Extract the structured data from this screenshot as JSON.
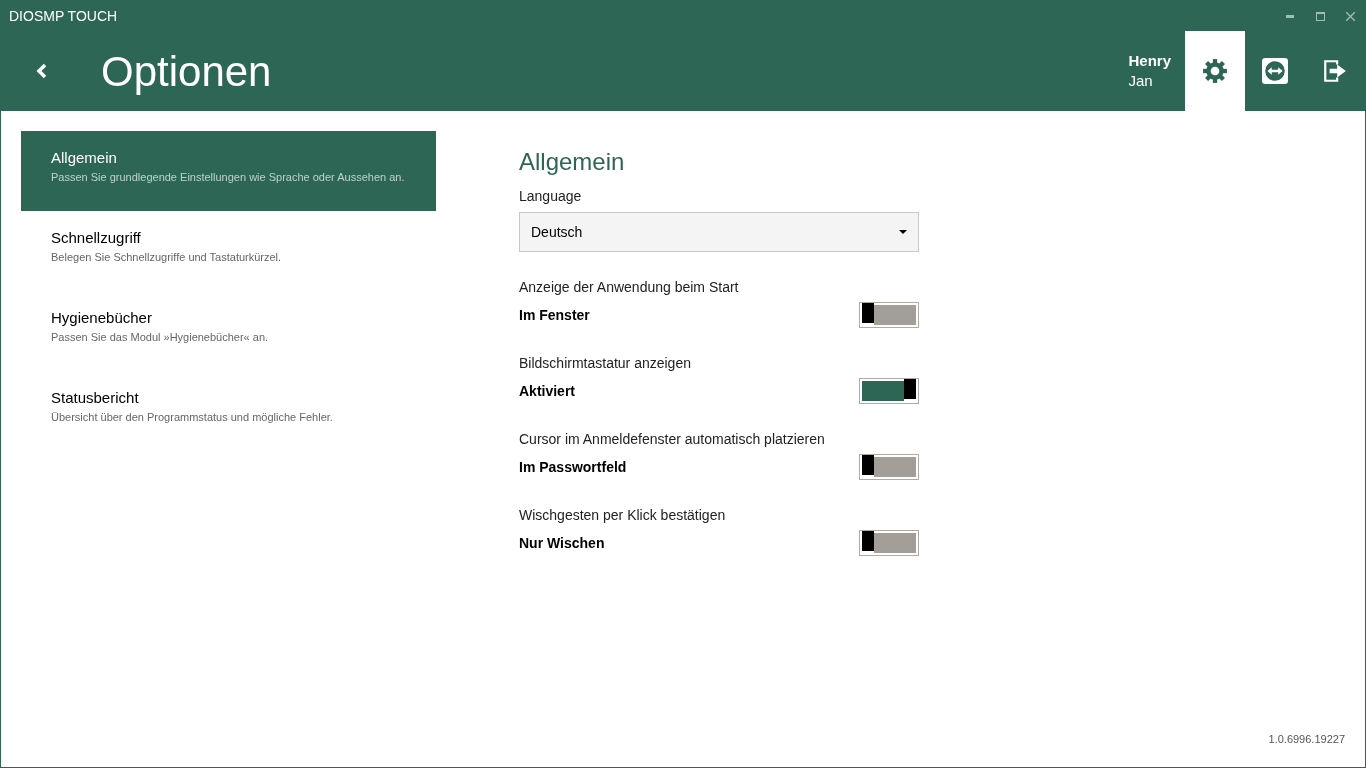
{
  "window": {
    "title": "DIOSMP TOUCH"
  },
  "header": {
    "title": "Optionen",
    "user": {
      "first": "Henry",
      "last": "Jan"
    },
    "actions": [
      {
        "kind": "settings",
        "selected": true
      },
      {
        "kind": "remote",
        "selected": false
      },
      {
        "kind": "logout",
        "selected": false
      }
    ]
  },
  "sidebar": {
    "items": [
      {
        "title": "Allgemein",
        "description": "Passen Sie grundlegende Einstellungen wie Sprache oder Aussehen an.",
        "selected": true
      },
      {
        "title": "Schnellzugriff",
        "description": "Belegen Sie Schnellzugriffe und Tastaturkürzel.",
        "selected": false
      },
      {
        "title": "Hygienebücher",
        "description": "Passen Sie das Modul »Hygienebücher« an.",
        "selected": false
      },
      {
        "title": "Statusbericht",
        "description": "Übersicht über den Programmstatus und mögliche Fehler.",
        "selected": false
      }
    ]
  },
  "content": {
    "heading": "Allgemein",
    "language": {
      "label": "Language",
      "value": "Deutsch"
    },
    "settings": [
      {
        "label": "Anzeige der Anwendung beim Start",
        "value": "Im Fenster",
        "on": false
      },
      {
        "label": "Bildschirmtastatur anzeigen",
        "value": "Aktiviert",
        "on": true
      },
      {
        "label": "Cursor im Anmeldefenster automatisch platzieren",
        "value": "Im Passwortfeld",
        "on": false
      },
      {
        "label": "Wischgesten per Klick bestätigen",
        "value": "Nur Wischen",
        "on": false
      }
    ]
  },
  "status_bar": {
    "version": "1.0.6996.19227"
  }
}
